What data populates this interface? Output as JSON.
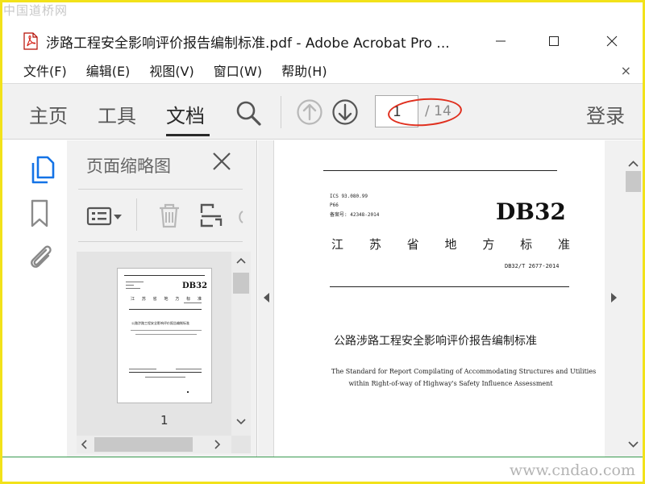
{
  "watermark": {
    "top": "中国道桥网",
    "bottom": "www.cndao.com"
  },
  "window": {
    "title": "涉路工程安全影响评价报告编制标准.pdf - Adobe Acrobat Pro ...",
    "icons": [
      "pdf-file-icon",
      "minimize-icon",
      "maximize-icon",
      "close-icon"
    ]
  },
  "menu": {
    "items": [
      {
        "label": "文件(F)"
      },
      {
        "label": "编辑(E)"
      },
      {
        "label": "视图(V)"
      },
      {
        "label": "窗口(W)"
      },
      {
        "label": "帮助(H)"
      }
    ],
    "close": "×"
  },
  "toolbar": {
    "tabs": [
      {
        "label": "主页"
      },
      {
        "label": "工具"
      },
      {
        "label": "文档",
        "active": true
      }
    ],
    "page_current": "1",
    "page_total": "/ 14",
    "login": "登录",
    "icons": [
      "search-icon",
      "page-up-icon",
      "page-down-icon"
    ]
  },
  "sidebar": {
    "rail_icons": [
      "pages-icon",
      "bookmark-icon",
      "attachment-icon"
    ],
    "thumbnails_title": "页面缩略图",
    "thumbnail_page_number": "1",
    "tool_icons": [
      "options-menu-icon",
      "delete-icon",
      "page-tool-icon"
    ]
  },
  "document": {
    "ics": "ICS 93.080.99",
    "class": "P66",
    "record": "备案号: 42348-2014",
    "standard_mark": "DB32",
    "province": [
      "江",
      "苏",
      "省",
      "地",
      "方",
      "标",
      "准"
    ],
    "code": "DB32/T 2677-2014",
    "title_cn": "公路涉路工程安全影响评价报告编制标准",
    "title_en_1": "The Standard for Report Compilating of Accommodating Structures and Utilities",
    "title_en_2": "within Right-of-way of Highway's Safety Influence Assessment"
  },
  "colors": {
    "accent_red": "#e0301f",
    "toolbar_bg": "#f1f1f1",
    "frame": "#f2e21a"
  }
}
